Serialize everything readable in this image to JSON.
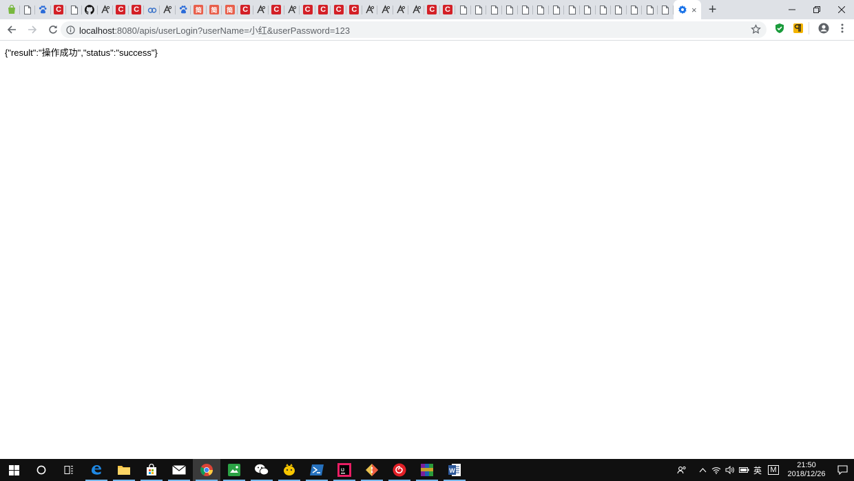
{
  "browser": {
    "tabs": [
      {
        "icon": "shopping-bag-icon"
      },
      {
        "icon": "doc-icon"
      },
      {
        "icon": "paw-icon"
      },
      {
        "icon": "c-red-icon"
      },
      {
        "icon": "doc-icon"
      },
      {
        "icon": "github-icon"
      },
      {
        "icon": "anime-icon"
      },
      {
        "icon": "c-red-icon"
      },
      {
        "icon": "c-red-icon"
      },
      {
        "icon": "cloud-icon"
      },
      {
        "icon": "anime-icon"
      },
      {
        "icon": "paw-icon"
      },
      {
        "icon": "jian-red-icon"
      },
      {
        "icon": "jian-red-icon"
      },
      {
        "icon": "jian-red-icon"
      },
      {
        "icon": "c-red-icon"
      },
      {
        "icon": "anime-icon"
      },
      {
        "icon": "c-red-icon"
      },
      {
        "icon": "anime-icon"
      },
      {
        "icon": "c-red-icon"
      },
      {
        "icon": "c-red-icon"
      },
      {
        "icon": "c-red-icon"
      },
      {
        "icon": "c-red-icon"
      },
      {
        "icon": "anime-icon"
      },
      {
        "icon": "anime-icon"
      },
      {
        "icon": "anime-icon"
      },
      {
        "icon": "anime-icon"
      },
      {
        "icon": "c-red-icon"
      },
      {
        "icon": "c-red-icon"
      },
      {
        "icon": "doc-icon"
      },
      {
        "icon": "doc-icon"
      },
      {
        "icon": "doc-icon"
      },
      {
        "icon": "doc-icon"
      },
      {
        "icon": "doc-icon"
      },
      {
        "icon": "doc-icon"
      },
      {
        "icon": "doc-icon"
      },
      {
        "icon": "doc-icon"
      },
      {
        "icon": "doc-icon"
      },
      {
        "icon": "doc-icon"
      },
      {
        "icon": "doc-icon"
      },
      {
        "icon": "doc-icon"
      },
      {
        "icon": "doc-icon"
      },
      {
        "icon": "doc-icon"
      }
    ],
    "active_tab": {
      "icon": "gear-icon",
      "close_label": "×"
    },
    "new_tab_label": "+",
    "window_controls": {
      "minimize": "—",
      "restore": "❐",
      "close": "✕"
    },
    "url": {
      "host": "localhost",
      "rest": ":8080/apis/userLogin?userName=小红&userPassword=123"
    }
  },
  "page": {
    "json_text": "{\"result\":\"操作成功\",\"status\":\"success\"}"
  },
  "taskbar": {
    "apps": [
      {
        "name": "start-button",
        "icon": "windows-logo-icon"
      },
      {
        "name": "cortana-button",
        "icon": "circle-icon"
      },
      {
        "name": "task-view-button",
        "icon": "task-view-icon"
      },
      {
        "name": "edge-app",
        "icon": "edge-icon"
      },
      {
        "name": "file-explorer-app",
        "icon": "folder-icon"
      },
      {
        "name": "store-app",
        "icon": "store-icon"
      },
      {
        "name": "mail-app",
        "icon": "mail-icon"
      },
      {
        "name": "chrome-app",
        "icon": "chrome-icon"
      },
      {
        "name": "green-app",
        "icon": "green-app-icon"
      },
      {
        "name": "wechat-app",
        "icon": "wechat-icon"
      },
      {
        "name": "yellow-app",
        "icon": "yellow-app-icon"
      },
      {
        "name": "powershell-app",
        "icon": "powershell-icon"
      },
      {
        "name": "intellij-app",
        "icon": "intellij-icon"
      },
      {
        "name": "git-app",
        "icon": "git-icon"
      },
      {
        "name": "netease-music-app",
        "icon": "music-icon"
      },
      {
        "name": "winrar-app",
        "icon": "winrar-icon"
      },
      {
        "name": "word-app",
        "icon": "word-icon"
      }
    ],
    "tray": {
      "ime_label": "英",
      "m_label": "M",
      "time": "21:50",
      "date": "2018/12/26"
    }
  },
  "colors": {
    "tabstrip_bg": "#dee1e6",
    "omnibox_bg": "#f1f3f4",
    "taskbar_bg": "#101010",
    "c_icon": "#d32027",
    "running_indicator": "#76b9ed"
  }
}
